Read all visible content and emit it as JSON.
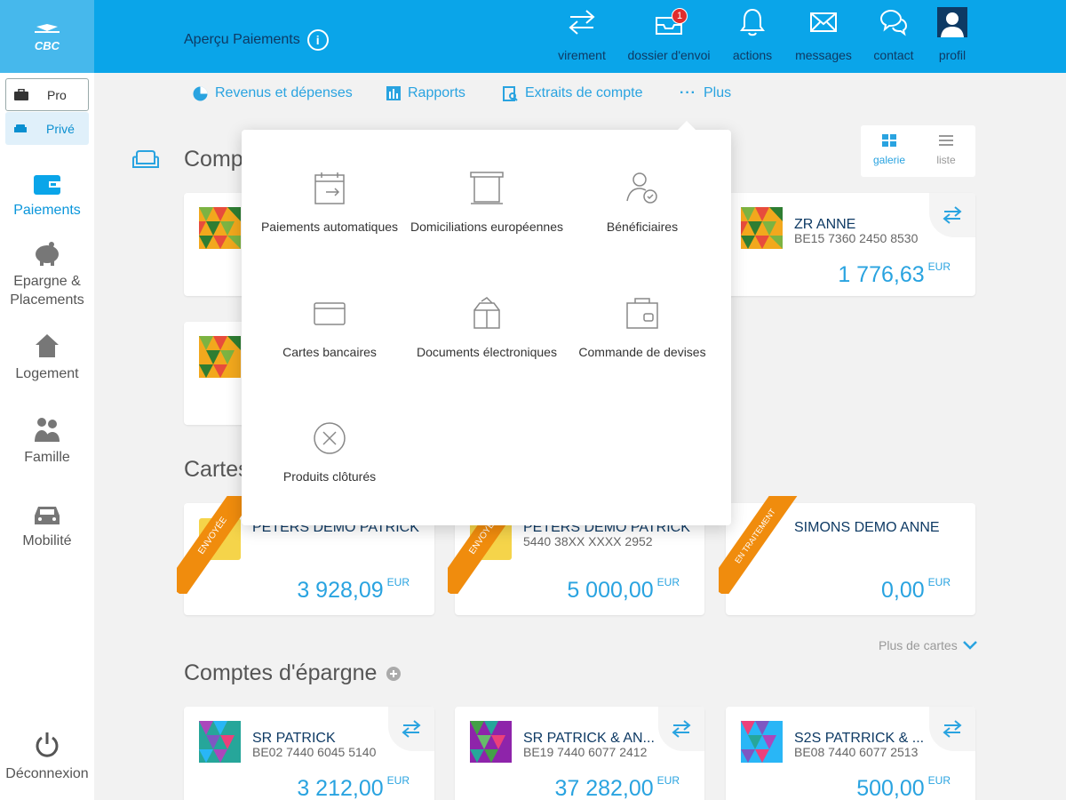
{
  "app": {
    "logo_text": "CBC",
    "page_title": "Aperçu Paiements",
    "info_icon": "i"
  },
  "topnav": [
    {
      "label": "virement",
      "icon": "transfer-icon"
    },
    {
      "label": "dossier d'envoi",
      "icon": "outbox-icon",
      "badge": "1"
    },
    {
      "label": "actions",
      "icon": "bell-icon"
    },
    {
      "label": "messages",
      "icon": "envelope-icon"
    },
    {
      "label": "contact",
      "icon": "chat-icon"
    },
    {
      "label": "profil",
      "icon": "avatar-icon"
    }
  ],
  "segment": {
    "pro": "Pro",
    "prive": "Privé"
  },
  "sidebar": [
    {
      "label": "Paiements",
      "icon": "wallet-icon"
    },
    {
      "label": "Epargne & Placements",
      "icon": "piggy-bank-icon"
    },
    {
      "label": "Logement",
      "icon": "house-icon"
    },
    {
      "label": "Famille",
      "icon": "family-icon"
    },
    {
      "label": "Mobilité",
      "icon": "car-icon"
    }
  ],
  "logout": "Déconnexion",
  "subnav": [
    {
      "label": "Revenus et dépenses",
      "icon": "pie-chart-icon"
    },
    {
      "label": "Rapports",
      "icon": "bar-chart-icon"
    },
    {
      "label": "Extraits de compte",
      "icon": "statement-icon"
    },
    {
      "label": "Plus",
      "icon": "dots-icon"
    }
  ],
  "view_toggle": {
    "gallery": "galerie",
    "list": "liste"
  },
  "sections": {
    "accounts": "Comp",
    "cards": "Cartes",
    "savings": "Comptes d'épargne"
  },
  "more_cards": "Plus de cartes",
  "currency": "EUR",
  "current_accounts": [
    {
      "name": "ZR ANNE",
      "iban": "BE15 7360 2450 8530",
      "amount": "1 776,63"
    }
  ],
  "cards": [
    {
      "name": "PETERS DEMO PATRICK",
      "number": "",
      "amount": "3 928,09",
      "ribbon": "ENVOYÉE"
    },
    {
      "name": "PETERS DEMO PATRICK",
      "number": "5440 38XX XXXX 2952",
      "amount": "5 000,00",
      "ribbon": "ENVOYÉE"
    },
    {
      "name": "SIMONS DEMO ANNE",
      "number": "",
      "amount": "0,00",
      "ribbon": "EN TRAITEMENT"
    }
  ],
  "savings": [
    {
      "name": "SR PATRICK",
      "iban": "BE02 7440 6045 5140",
      "amount": "3 212,00"
    },
    {
      "name": "SR PATRICK & AN...",
      "iban": "BE19 7440 6077 2412",
      "amount": "37 282,00"
    },
    {
      "name": "S2S PATRRICK & ...",
      "iban": "BE08 7440 6077 2513",
      "amount": "500,00"
    }
  ],
  "popup_menu": [
    {
      "label": "Paiements automatiques",
      "icon": "calendar-arrow-icon"
    },
    {
      "label": "Domiciliations européennes",
      "icon": "document-stack-icon"
    },
    {
      "label": "Bénéficiaires",
      "icon": "user-check-icon"
    },
    {
      "label": "Cartes bancaires",
      "icon": "credit-card-icon"
    },
    {
      "label": "Documents électroniques",
      "icon": "open-box-icon"
    },
    {
      "label": "Commande de devises",
      "icon": "currency-wallet-icon"
    },
    {
      "label": "Produits clôturés",
      "icon": "closed-circle-icon"
    }
  ]
}
